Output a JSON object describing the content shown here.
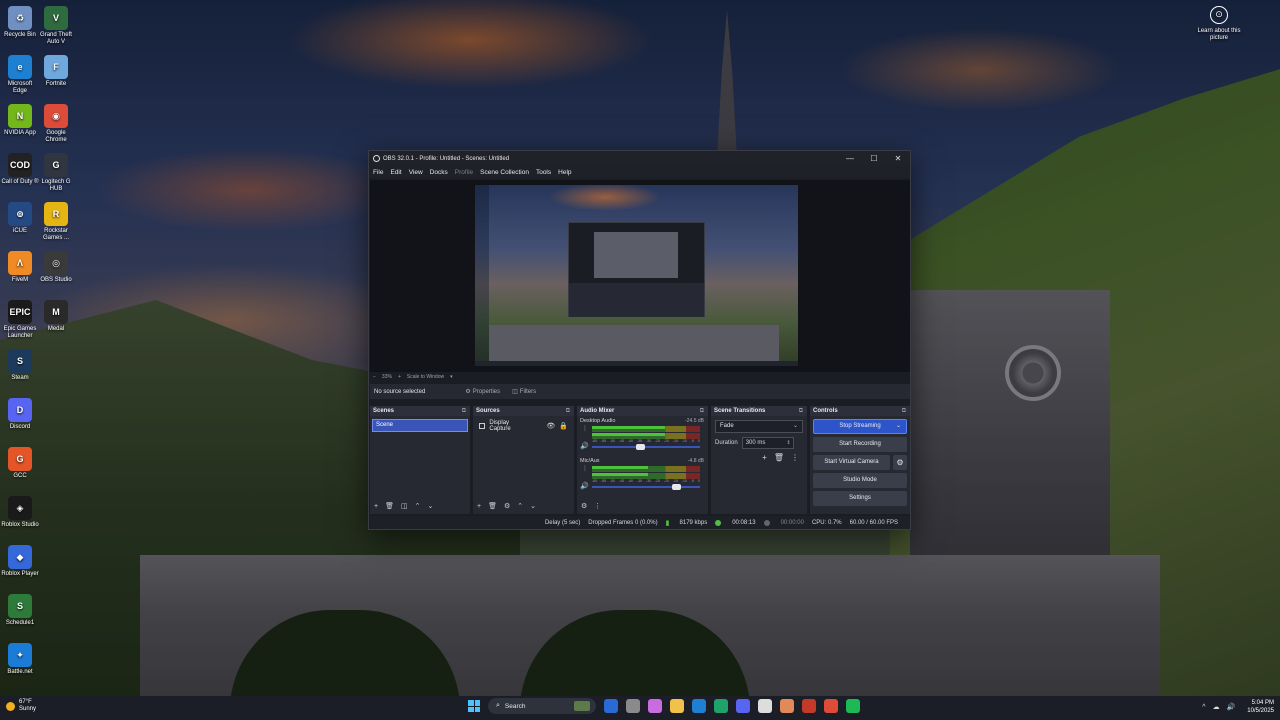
{
  "desktop": {
    "icons": [
      {
        "label": "Recycle Bin",
        "glyph": "♻",
        "color": "#6f90c0"
      },
      {
        "label": "Grand Theft Auto V",
        "glyph": "V",
        "color": "#2e6b3e"
      },
      {
        "label": "Microsoft Edge",
        "glyph": "e",
        "color": "#1f7fd1"
      },
      {
        "label": "Fortnite",
        "glyph": "F",
        "color": "#6fa8dc"
      },
      {
        "label": "NVIDIA App",
        "glyph": "N",
        "color": "#74b71b"
      },
      {
        "label": "Google Chrome",
        "glyph": "◉",
        "color": "#dd4b39"
      },
      {
        "label": "Call of Duty ®",
        "glyph": "COD",
        "color": "#222222"
      },
      {
        "label": "Logitech G HUB",
        "glyph": "G",
        "color": "#30363f"
      },
      {
        "label": "iCUE",
        "glyph": "⊚",
        "color": "#244a86"
      },
      {
        "label": "Rockstar Games ...",
        "glyph": "R",
        "color": "#e5b513"
      },
      {
        "label": "FiveM",
        "glyph": "Λ",
        "color": "#f08a24"
      },
      {
        "label": "OBS Studio",
        "glyph": "◎",
        "color": "#3a3a3a"
      },
      {
        "label": "Epic Games Launcher",
        "glyph": "EPIC",
        "color": "#1b1b1b"
      },
      {
        "label": "Medal",
        "glyph": "M",
        "color": "#2a2a2a"
      },
      {
        "label": "Steam",
        "glyph": "S",
        "color": "#1b3a5c"
      },
      {
        "label": "Discord",
        "glyph": "D",
        "color": "#5865f2"
      },
      {
        "label": "GCC",
        "glyph": "G",
        "color": "#e45528"
      },
      {
        "label": "Roblox Studio",
        "glyph": "◈",
        "color": "#1a1a1a"
      },
      {
        "label": "Roblox Player",
        "glyph": "◆",
        "color": "#3568d8"
      },
      {
        "label": "Schedule1",
        "glyph": "S",
        "color": "#2d7a3a"
      },
      {
        "label": "Battle.net",
        "glyph": "✦",
        "color": "#1a7cd6"
      }
    ],
    "learn_label": "Learn about this picture",
    "learn_glyph": "⊙"
  },
  "obs": {
    "title": "OBS 32.0.1 - Profile: Untitled - Scenes: Untitled",
    "window_buttons": [
      "—",
      "☐",
      "✕"
    ],
    "menu": [
      "File",
      "Edit",
      "View",
      "Docks",
      "Profile",
      "Scene Collection",
      "Tools",
      "Help"
    ],
    "zoom": {
      "minus": "−",
      "value": "33%",
      "plus": "+",
      "mode": "Scale to Window",
      "caret": "▾"
    },
    "source_bar": {
      "status": "No source selected",
      "properties": "Properties",
      "filters": "Filters",
      "properties_glyph": "⚙",
      "filters_glyph": "◫"
    },
    "scenes": {
      "title": "Scenes",
      "items": [
        "Scene"
      ],
      "footer": [
        "+",
        "🗑",
        "◫",
        "⌃",
        "⌄"
      ]
    },
    "sources": {
      "title": "Sources",
      "items": [
        {
          "name": "Display Capture",
          "eye": "👁",
          "lock": "🔒"
        }
      ],
      "footer": [
        "+",
        "🗑",
        "⚙",
        "⌃",
        "⌄"
      ]
    },
    "mixer": {
      "title": "Audio Mixer",
      "scale": [
        "-60",
        "-55",
        "-50",
        "-45",
        "-40",
        "-35",
        "-30",
        "-25",
        "-20",
        "-15",
        "-10",
        "-5",
        "0"
      ],
      "channels": [
        {
          "name": "Desktop Audio",
          "db": "-24.5 dB",
          "level": 0.68,
          "volume": 0.44
        },
        {
          "name": "Mic/Aux",
          "db": "-4.8 dB",
          "level": 0.52,
          "volume": 0.78
        }
      ],
      "footer": [
        "⚙",
        "⋮"
      ]
    },
    "transitions": {
      "title": "Scene Transitions",
      "selected": "Fade",
      "duration_label": "Duration",
      "duration_value": "300 ms",
      "tools": [
        "+",
        "🗑",
        "⋮"
      ]
    },
    "controls": {
      "title": "Controls",
      "stop_streaming": "Stop Streaming",
      "start_recording": "Start Recording",
      "start_virtual_camera": "Start Virtual Camera",
      "studio_mode": "Studio Mode",
      "settings": "Settings"
    },
    "dock_glyph": "⧉",
    "status": {
      "delay": "Delay (5 sec)",
      "dropped": "Dropped Frames 0 (0.0%)",
      "bitrate": "8179 kbps",
      "stream_time": "00:08:13",
      "rec_time": "00:00:00",
      "cpu": "CPU: 0.7%",
      "fps": "60.00 / 60.00 FPS"
    }
  },
  "taskbar": {
    "weather_temp": "67°F",
    "weather_desc": "Sunny",
    "search_placeholder": "Search",
    "apps": [
      "#2a6ad4",
      "#8a8a8a",
      "#c86ce0",
      "#f0c24a",
      "#1f7fd1",
      "#1fa36b",
      "#5865f2",
      "#dddddd",
      "#e08a5a",
      "#c43a2a",
      "#dd4b39",
      "#1db954"
    ],
    "tray": [
      "^",
      "☁",
      "🔊"
    ],
    "time": "5:04 PM",
    "date": "10/5/2025"
  }
}
